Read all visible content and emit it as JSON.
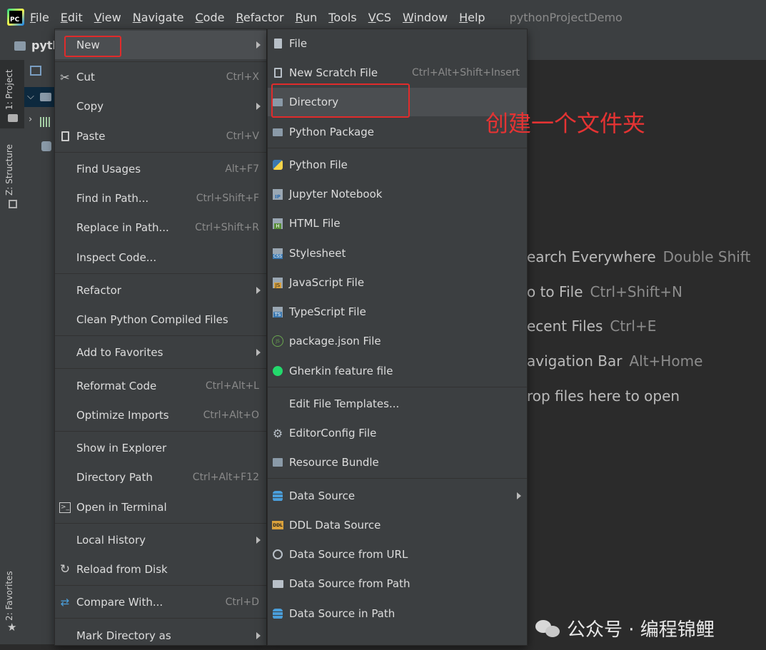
{
  "menubar": {
    "items": [
      {
        "label": "File",
        "m": "F",
        "rest": "ile"
      },
      {
        "label": "Edit",
        "m": "E",
        "rest": "dit"
      },
      {
        "label": "View",
        "m": "V",
        "rest": "iew"
      },
      {
        "label": "Navigate",
        "m": "N",
        "rest": "avigate"
      },
      {
        "label": "Code",
        "m": "C",
        "rest": "ode"
      },
      {
        "label": "Refactor",
        "m": "R",
        "rest": "efactor"
      },
      {
        "label": "Run",
        "m": "R",
        "rest": "un"
      },
      {
        "label": "Tools",
        "m": "T",
        "rest": "ools"
      },
      {
        "label": "VCS",
        "m": "V",
        "rest": "CS"
      },
      {
        "label": "Window",
        "m": "W",
        "rest": "indow"
      },
      {
        "label": "Help",
        "m": "H",
        "rest": "elp"
      }
    ],
    "window_title": "pythonProjectDemo"
  },
  "toolstrip": {
    "project_prefix": "pyth"
  },
  "sidebar": {
    "tab_project": "1: Project",
    "tab_structure": "Z: Structure",
    "tab_favorites": "2: Favorites"
  },
  "editor_hints": [
    {
      "action": "earch Everywhere",
      "key": "Double Shift"
    },
    {
      "action": "o to File",
      "key": "Ctrl+Shift+N"
    },
    {
      "action": "ecent Files",
      "key": "Ctrl+E"
    },
    {
      "action": "avigation Bar",
      "key": "Alt+Home"
    },
    {
      "action": "rop files here to open",
      "key": ""
    }
  ],
  "context_menu": {
    "items": [
      {
        "label": "New",
        "shortcut": "",
        "submenu": true
      },
      {
        "label": "Cut",
        "shortcut": "Ctrl+X"
      },
      {
        "label": "Copy",
        "shortcut": "",
        "submenu": true
      },
      {
        "label": "Paste",
        "shortcut": "Ctrl+V"
      },
      {
        "label": "Find Usages",
        "shortcut": "Alt+F7"
      },
      {
        "label": "Find in Path...",
        "shortcut": "Ctrl+Shift+F"
      },
      {
        "label": "Replace in Path...",
        "shortcut": "Ctrl+Shift+R"
      },
      {
        "label": "Inspect Code...",
        "shortcut": ""
      },
      {
        "label": "Refactor",
        "shortcut": "",
        "submenu": true
      },
      {
        "label": "Clean Python Compiled Files",
        "shortcut": ""
      },
      {
        "label": "Add to Favorites",
        "shortcut": "",
        "submenu": true
      },
      {
        "label": "Reformat Code",
        "shortcut": "Ctrl+Alt+L"
      },
      {
        "label": "Optimize Imports",
        "shortcut": "Ctrl+Alt+O"
      },
      {
        "label": "Show in Explorer",
        "shortcut": ""
      },
      {
        "label": "Directory Path",
        "shortcut": "Ctrl+Alt+F12"
      },
      {
        "label": "Open in Terminal",
        "shortcut": ""
      },
      {
        "label": "Local History",
        "shortcut": "",
        "submenu": true
      },
      {
        "label": "Reload from Disk",
        "shortcut": ""
      },
      {
        "label": "Compare With...",
        "shortcut": "Ctrl+D"
      },
      {
        "label": "Mark Directory as",
        "shortcut": "",
        "submenu": true
      }
    ]
  },
  "new_submenu": {
    "items": [
      {
        "label": "File",
        "shortcut": ""
      },
      {
        "label": "New Scratch File",
        "shortcut": "Ctrl+Alt+Shift+Insert"
      },
      {
        "label": "Directory",
        "shortcut": ""
      },
      {
        "label": "Python Package",
        "shortcut": ""
      },
      {
        "label": "Python File",
        "shortcut": ""
      },
      {
        "label": "Jupyter Notebook",
        "shortcut": ""
      },
      {
        "label": "HTML File",
        "shortcut": ""
      },
      {
        "label": "Stylesheet",
        "shortcut": ""
      },
      {
        "label": "JavaScript File",
        "shortcut": ""
      },
      {
        "label": "TypeScript File",
        "shortcut": ""
      },
      {
        "label": "package.json File",
        "shortcut": ""
      },
      {
        "label": "Gherkin feature file",
        "shortcut": ""
      },
      {
        "label": "Edit File Templates...",
        "shortcut": ""
      },
      {
        "label": "EditorConfig File",
        "shortcut": ""
      },
      {
        "label": "Resource Bundle",
        "shortcut": ""
      },
      {
        "label": "Data Source",
        "shortcut": "",
        "submenu": true
      },
      {
        "label": "DDL Data Source",
        "shortcut": ""
      },
      {
        "label": "Data Source from URL",
        "shortcut": ""
      },
      {
        "label": "Data Source from Path",
        "shortcut": ""
      },
      {
        "label": "Data Source in Path",
        "shortcut": ""
      }
    ]
  },
  "annotation": {
    "text": "创建一个文件夹"
  },
  "watermark": {
    "text": "公众号 · 编程锦鲤"
  },
  "colors": {
    "highlight": "#e02b2b",
    "menu_bg": "#3c3f41",
    "selected_bg": "#4b4e51"
  }
}
